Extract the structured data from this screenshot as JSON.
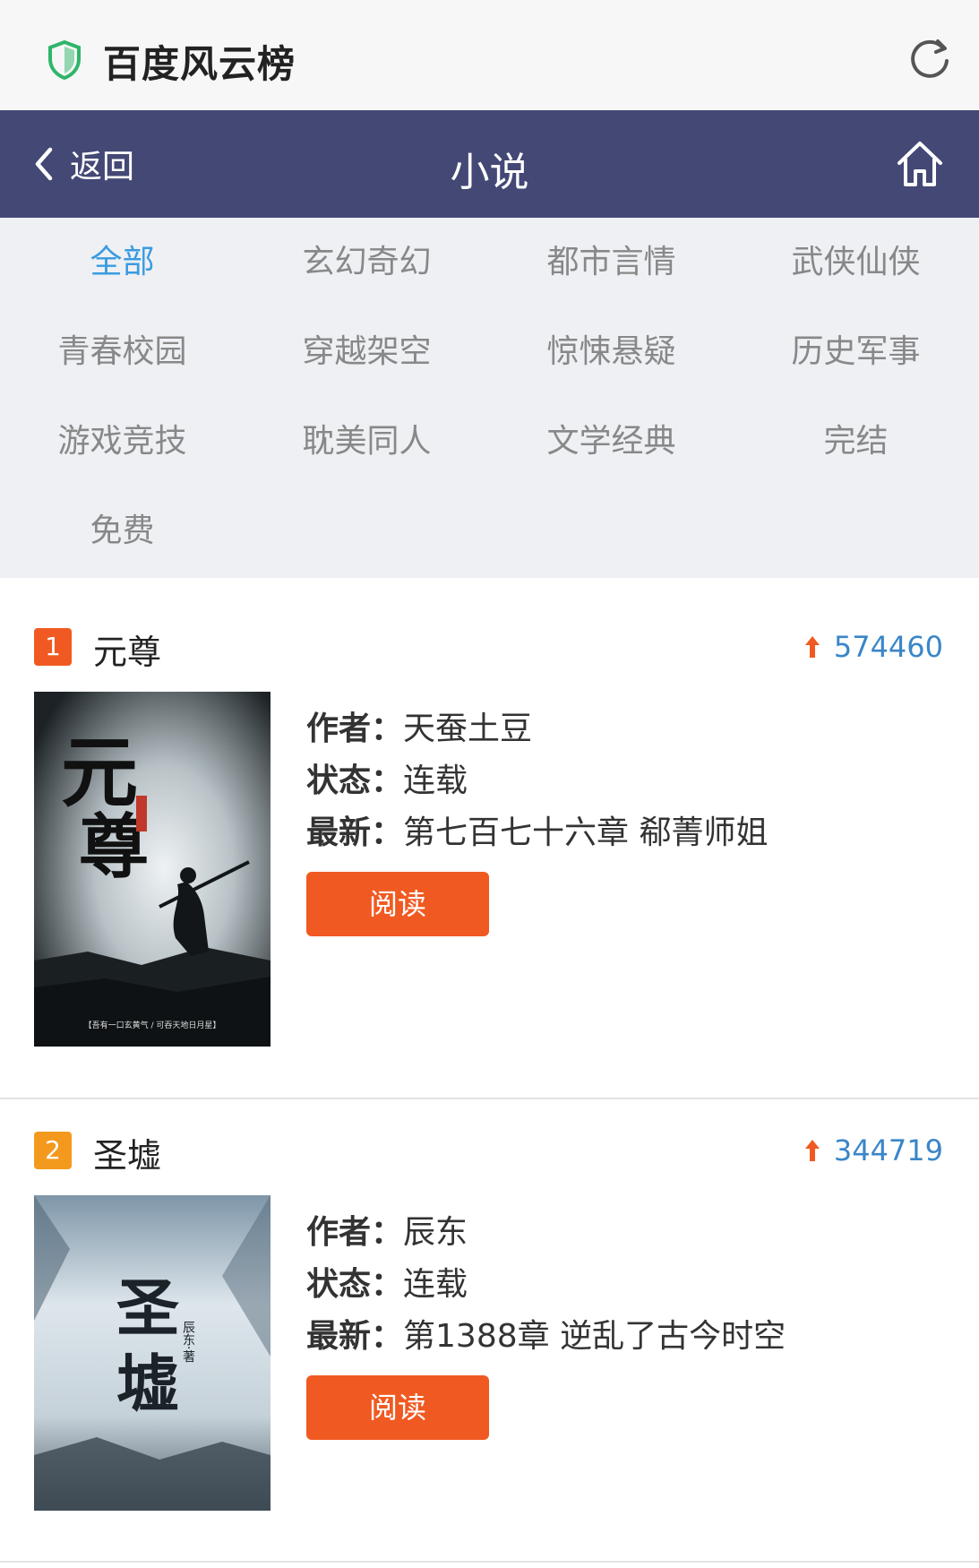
{
  "app": {
    "title": "百度风云榜",
    "shield_icon": "shield-icon",
    "refresh_icon": "refresh-icon"
  },
  "nav": {
    "back_label": "返回",
    "title": "小说",
    "home_icon": "home-icon",
    "bg_color": "#444875"
  },
  "categories": [
    {
      "label": "全部",
      "active": true
    },
    {
      "label": "玄幻奇幻"
    },
    {
      "label": "都市言情"
    },
    {
      "label": "武侠仙侠"
    },
    {
      "label": "青春校园"
    },
    {
      "label": "穿越架空"
    },
    {
      "label": "惊悚悬疑"
    },
    {
      "label": "历史军事"
    },
    {
      "label": "游戏竞技"
    },
    {
      "label": "耽美同人"
    },
    {
      "label": "文学经典"
    },
    {
      "label": "完结"
    },
    {
      "label": "免费"
    }
  ],
  "books": [
    {
      "rank": "1",
      "rank_color": "#f05a22",
      "title": "元尊",
      "hot": "574460",
      "author_label": "作者：",
      "author": "天蚕土豆",
      "status_label": "状态：",
      "status": "连载",
      "latest_label": "最新：",
      "latest": "第七百七十六章 郗菁师姐",
      "read_label": "阅读",
      "cover_title": "元尊",
      "cover_caption": "【吾有一口玄黄气 / 可吞天地日月星】"
    },
    {
      "rank": "2",
      "rank_color": "#f39a1e",
      "title": "圣墟",
      "hot": "344719",
      "author_label": "作者：",
      "author": "辰东",
      "status_label": "状态：",
      "status": "连载",
      "latest_label": "最新：",
      "latest": "第1388章 逆乱了古今时空",
      "read_label": "阅读",
      "cover_title": "圣墟",
      "cover_author": "辰东·著"
    }
  ],
  "colors": {
    "accent_blue": "#3a9be0",
    "button_orange": "#f05a22",
    "hot_arrow": "#f05a22"
  }
}
